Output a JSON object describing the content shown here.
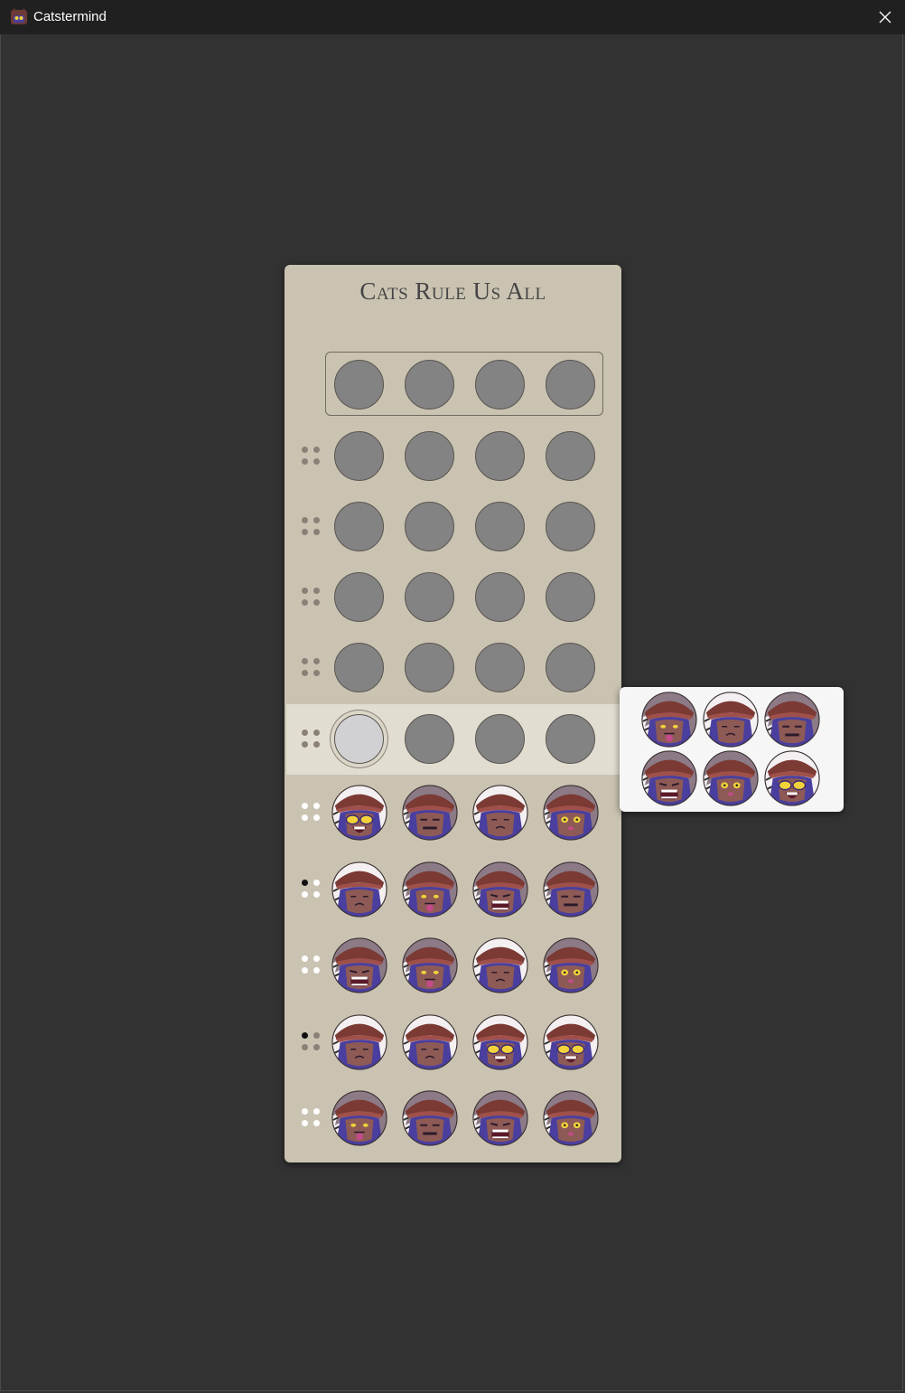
{
  "window": {
    "title": "Catstermind"
  },
  "board": {
    "title": "Cats Rule Us All",
    "secret_pegs": 4,
    "empty_rows": 5,
    "active_row_selected_slot": 1,
    "guesses": [
      {
        "cats": [
          "cat-glasses-open",
          "cat-smirk",
          "cat-frown",
          "cat-yellow-eyes"
        ],
        "feedback": [
          "white",
          "white",
          "white",
          "white"
        ]
      },
      {
        "cats": [
          "cat-frown",
          "cat-tongue",
          "cat-yell",
          "cat-smirk"
        ],
        "feedback": [
          "black",
          "white",
          "white",
          "white"
        ]
      },
      {
        "cats": [
          "cat-yell",
          "cat-tongue",
          "cat-frown",
          "cat-yellow-eyes"
        ],
        "feedback": [
          "white",
          "white",
          "white",
          "white"
        ]
      },
      {
        "cats": [
          "cat-frown",
          "cat-frown",
          "cat-glasses-open",
          "cat-glasses-open"
        ],
        "feedback": [
          "black",
          "gray",
          "gray",
          "gray"
        ]
      },
      {
        "cats": [
          "cat-tongue",
          "cat-smirk",
          "cat-yell",
          "cat-yellow-eyes"
        ],
        "feedback": [
          "white",
          "white",
          "white",
          "white"
        ]
      }
    ]
  },
  "picker": {
    "options": [
      "cat-tongue",
      "cat-frown",
      "cat-smirk",
      "cat-yell",
      "cat-yellow-eyes",
      "cat-glasses-open"
    ]
  },
  "colors": {
    "background": "#323232",
    "titlebar": "#202020",
    "board": "#cac3b2",
    "active_row": "#e2ddd1",
    "empty_peg": "#838383",
    "selected_peg": "#d1d1d3",
    "hat": "#7b3a34",
    "hair": "#4a3f9e",
    "skin": "#8e5a56"
  }
}
